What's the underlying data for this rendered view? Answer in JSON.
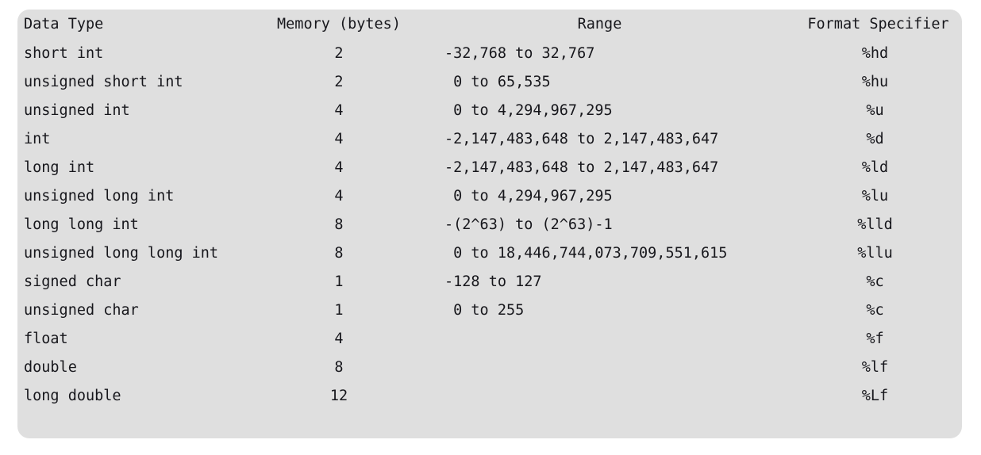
{
  "table": {
    "columns": [
      {
        "key": "type",
        "label": "Data Type"
      },
      {
        "key": "mem",
        "label": "Memory (bytes)"
      },
      {
        "key": "range",
        "label": "Range"
      },
      {
        "key": "fmt",
        "label": "Format Specifier"
      }
    ],
    "rows": [
      {
        "type": "short int",
        "mem": "2",
        "range": "-32,768 to 32,767",
        "fmt": "%hd"
      },
      {
        "type": "unsigned short int",
        "mem": "2",
        "range": " 0 to 65,535",
        "fmt": "%hu"
      },
      {
        "type": "unsigned int",
        "mem": "4",
        "range": " 0 to 4,294,967,295",
        "fmt": "%u"
      },
      {
        "type": "int",
        "mem": "4",
        "range": "-2,147,483,648 to 2,147,483,647",
        "fmt": "%d"
      },
      {
        "type": "long int",
        "mem": "4",
        "range": "-2,147,483,648 to 2,147,483,647",
        "fmt": "%ld"
      },
      {
        "type": "unsigned long int",
        "mem": "4",
        "range": " 0 to 4,294,967,295",
        "fmt": "%lu"
      },
      {
        "type": "long long int",
        "mem": "8",
        "range": "-(2^63) to (2^63)-1",
        "fmt": "%lld"
      },
      {
        "type": "unsigned long long int",
        "mem": "8",
        "range": " 0 to 18,446,744,073,709,551,615",
        "fmt": "%llu"
      },
      {
        "type": "signed char",
        "mem": "1",
        "range": "-128 to 127",
        "fmt": "%c"
      },
      {
        "type": "unsigned char",
        "mem": "1",
        "range": " 0 to 255",
        "fmt": "%c"
      },
      {
        "type": "float",
        "mem": "4",
        "range": "",
        "fmt": "%f"
      },
      {
        "type": "double",
        "mem": "8",
        "range": "",
        "fmt": "%lf"
      },
      {
        "type": "long double",
        "mem": "12",
        "range": "",
        "fmt": "%Lf"
      }
    ]
  },
  "theme": {
    "page_background": "#ffffff",
    "card_background": "#dfdfdf",
    "text_color": "#17171c"
  }
}
